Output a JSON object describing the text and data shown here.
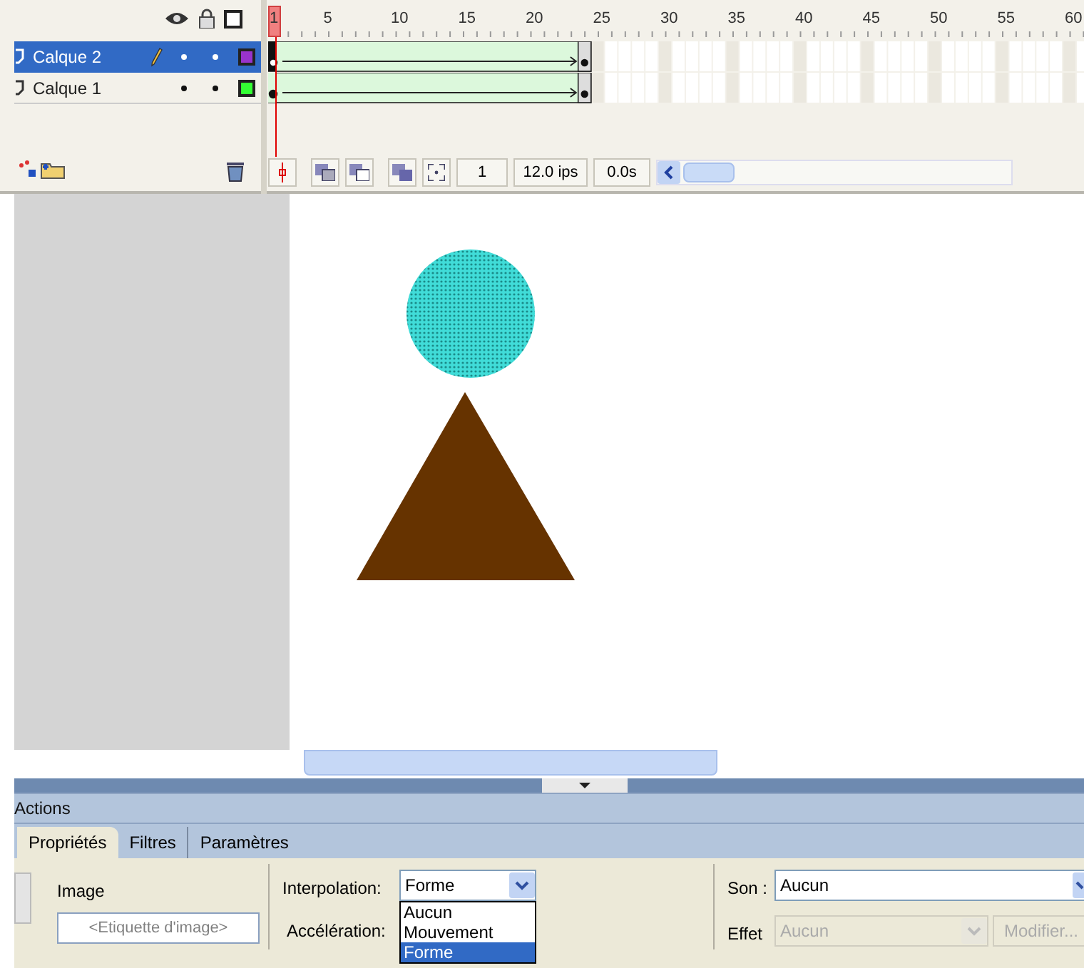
{
  "timeline": {
    "frame_numbers": [
      "1",
      "5",
      "10",
      "15",
      "20",
      "25",
      "30",
      "35",
      "40",
      "45",
      "50",
      "55",
      "60"
    ],
    "current_frame": "1",
    "fps": "12.0 ips",
    "time": "0.0s"
  },
  "layers": [
    {
      "name": "Calque 2",
      "selected": true,
      "color": "#9933cc"
    },
    {
      "name": "Calque 1",
      "selected": false,
      "color": "#33ff33"
    }
  ],
  "panel_title": "Actions",
  "tabs": [
    {
      "label": "Propriétés",
      "selected": true
    },
    {
      "label": "Filtres",
      "selected": false
    },
    {
      "label": "Paramètres",
      "selected": false
    }
  ],
  "properties": {
    "frame_title": "Image",
    "label_placeholder": "<Etiquette d'image>",
    "interpolation": {
      "label": "Interpolation:",
      "value": "Forme",
      "options": [
        {
          "label": "Aucun",
          "selected": false
        },
        {
          "label": "Mouvement",
          "selected": false
        },
        {
          "label": "Forme",
          "selected": true
        }
      ]
    },
    "easing_label": "Accélération:",
    "sound": {
      "label": "Son :",
      "value": "Aucun"
    },
    "effect": {
      "label": "Effet",
      "value": "Aucun",
      "disabled": true
    },
    "edit_button": "Modifier..."
  }
}
